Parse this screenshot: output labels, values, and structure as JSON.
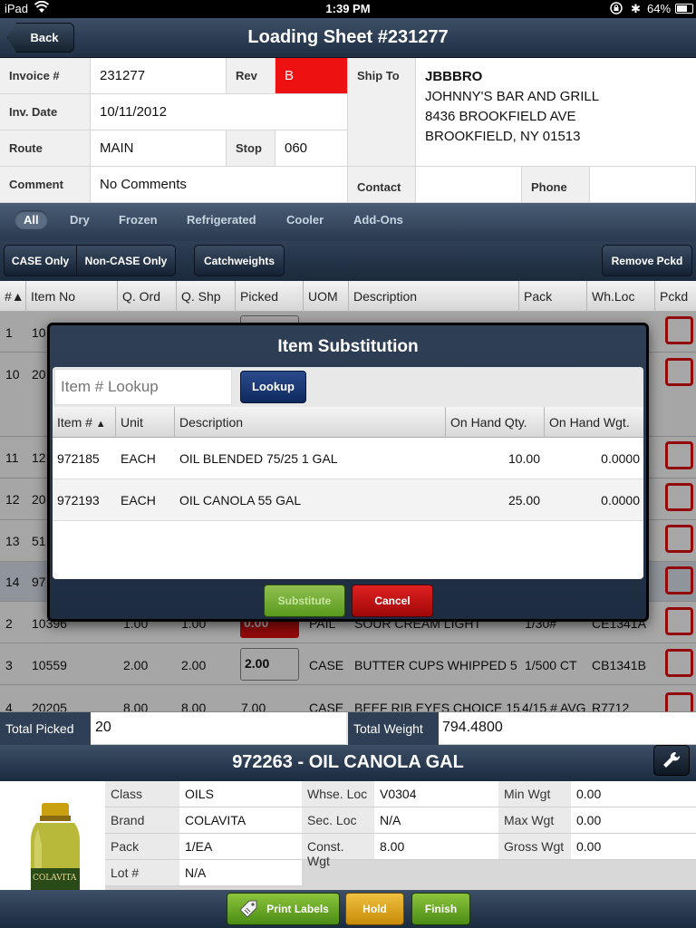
{
  "status": {
    "device": "iPad",
    "time": "1:39 PM",
    "battery": "64%"
  },
  "nav": {
    "title": "Loading Sheet #231277",
    "back": "Back"
  },
  "header": {
    "invoice_label": "Invoice #",
    "invoice": "231277",
    "rev_label": "Rev",
    "rev": "B",
    "invdate_label": "Inv. Date",
    "invdate": "10/11/2012",
    "route_label": "Route",
    "route": "MAIN",
    "stop_label": "Stop",
    "stop": "060",
    "comment_label": "Comment",
    "comment": "No Comments",
    "shipto_label": "Ship To",
    "ship_code": "JBBBRO",
    "ship_name": "JOHNNY'S BAR AND GRILL",
    "ship_addr": "8436 BROOKFIELD AVE",
    "ship_city": "BROOKFIELD, NY 01513",
    "contact_label": "Contact",
    "phone_label": "Phone"
  },
  "tabs": [
    "All",
    "Dry",
    "Frozen",
    "Refrigerated",
    "Cooler",
    "Add-Ons"
  ],
  "buttons": {
    "case_only": "CASE Only",
    "noncase_only": "Non-CASE Only",
    "catchweights": "Catchweights",
    "remove_pckd": "Remove Pckd"
  },
  "columns": [
    "#▲",
    "Item No",
    "Q. Ord",
    "Q. Shp",
    "Picked",
    "UOM",
    "Description",
    "Pack",
    "Wh.Loc",
    "Pckd"
  ],
  "rows_visible": [
    {
      "num": "1",
      "item": "10"
    },
    {
      "num": "10",
      "item": "20"
    },
    {
      "num": "11",
      "item": "12"
    },
    {
      "num": "12",
      "item": "20"
    },
    {
      "num": "13",
      "item": "51"
    },
    {
      "num": "14",
      "item": "97"
    }
  ],
  "rows_full": [
    {
      "num": "2",
      "item": "10396",
      "qord": "1.00",
      "qshp": "1.00",
      "picked": "0.00",
      "uom": "PAIL",
      "desc": "SOUR CREAM LIGHT",
      "pack": "1/30#",
      "loc": "CE1341A"
    },
    {
      "num": "3",
      "item": "10559",
      "qord": "2.00",
      "qshp": "2.00",
      "picked": "2.00",
      "uom": "CASE",
      "desc": "BUTTER CUPS WHIPPED 5 (",
      "pack": "1/500 CT",
      "loc": "CB1341B"
    },
    {
      "num": "4",
      "item": "20205",
      "qord": "8.00",
      "qshp": "8.00",
      "picked": "7.00",
      "uom": "CASE",
      "desc": "BEEF RIB EYES CHOICE 15 #",
      "pack": "4/15 # AVG",
      "loc": "R7712"
    }
  ],
  "totals": {
    "picked_label": "Total Picked",
    "picked": "20",
    "weight_label": "Total Weight",
    "weight": "794.4800"
  },
  "detail": {
    "title": "972263 - OIL CANOLA GAL",
    "class_label": "Class",
    "class": "OILS",
    "brand_label": "Brand",
    "brand": "COLAVITA",
    "pack_label": "Pack",
    "pack": "1/EA",
    "lot_label": "Lot #",
    "lot": "N/A",
    "whse_label": "Whse. Loc",
    "whse": "V0304",
    "sec_label": "Sec. Loc",
    "sec": "N/A",
    "const_label": "Const. Wgt",
    "const": "8.00",
    "min_label": "Min Wgt",
    "min": "0.00",
    "max_label": "Max Wgt",
    "max": "0.00",
    "gross_label": "Gross Wgt",
    "gross": "0.00",
    "bottle_text": "COLAVITA"
  },
  "bottom": {
    "print": "Print Labels",
    "hold": "Hold",
    "finish": "Finish"
  },
  "modal": {
    "title": "Item Substitution",
    "placeholder": "Item # Lookup",
    "lookup": "Lookup",
    "cols": [
      "Item #",
      "Unit",
      "Description",
      "On Hand Qty.",
      "On Hand Wgt."
    ],
    "rows": [
      {
        "item": "972185",
        "unit": "EACH",
        "desc": "OIL BLENDED 75/25 1 GAL",
        "qty": "10.00",
        "wgt": "0.0000"
      },
      {
        "item": "972193",
        "unit": "EACH",
        "desc": "OIL CANOLA 55 GAL",
        "qty": "25.00",
        "wgt": "0.0000"
      }
    ],
    "substitute": "Substitute",
    "cancel": "Cancel"
  },
  "colors": {
    "accent_red": "#e01010",
    "nav_dark": "#1f2f44",
    "green": "#5a9a1e",
    "gold": "#d8a010"
  }
}
